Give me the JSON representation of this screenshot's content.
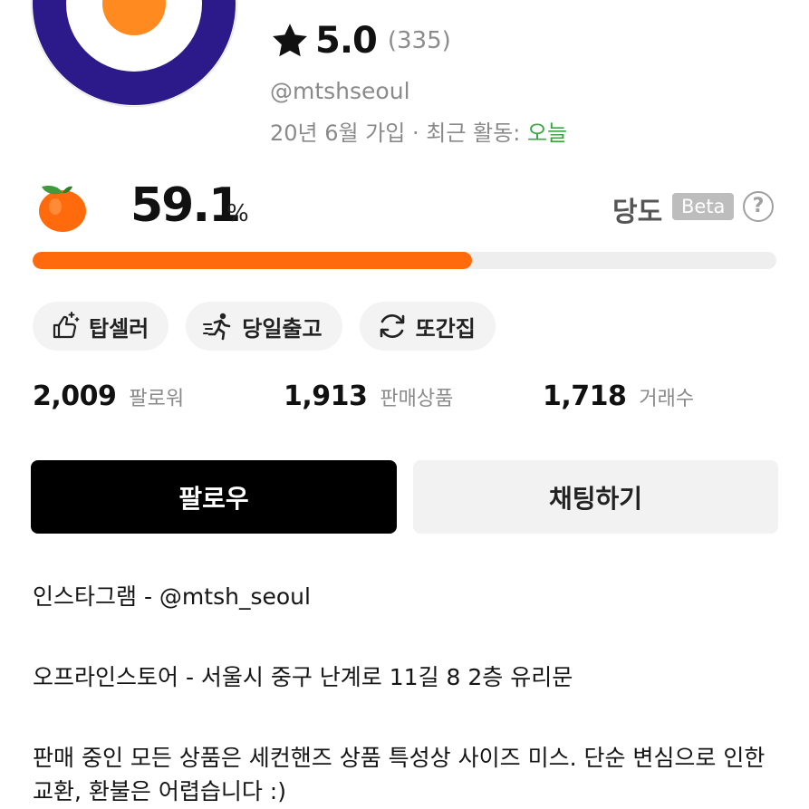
{
  "profile": {
    "rating": "5.0",
    "review_count": "(335)",
    "handle": "@mtshseoul",
    "joined_prefix": "20년 6월 가입 · 최근 활동: ",
    "last_active": "오늘",
    "avatar_colors": {
      "ring": "#2c1a8a",
      "inner": "#ffffff",
      "dot": "#ff8a1f"
    }
  },
  "sweetness": {
    "value": "59.1",
    "unit": "%",
    "label": "당도",
    "beta_label": "Beta",
    "help_symbol": "?",
    "level_percent": 59.1,
    "bar_color": "#ff6a0d"
  },
  "badges": [
    {
      "icon": "thumbs-up-sparkle-icon",
      "label": "탑셀러"
    },
    {
      "icon": "runner-icon",
      "label": "당일출고"
    },
    {
      "icon": "refresh-icon",
      "label": "또간집"
    }
  ],
  "stats": [
    {
      "value": "2,009",
      "label": "팔로워"
    },
    {
      "value": "1,913",
      "label": "판매상품"
    },
    {
      "value": "1,718",
      "label": "거래수"
    }
  ],
  "actions": {
    "follow_label": "팔로우",
    "chat_label": "채팅하기"
  },
  "description": {
    "line1": "인스타그램 - @mtsh_seoul",
    "line2": "오프라인스토어 - 서울시 중구 난계로 11길 8 2층 유리문",
    "line3": "판매 중인 모든 상품은 세컨핸즈 상품 특성상 사이즈 미스. 단순 변심으로 인한 교환, 환불은 어렵습니다 :)"
  }
}
